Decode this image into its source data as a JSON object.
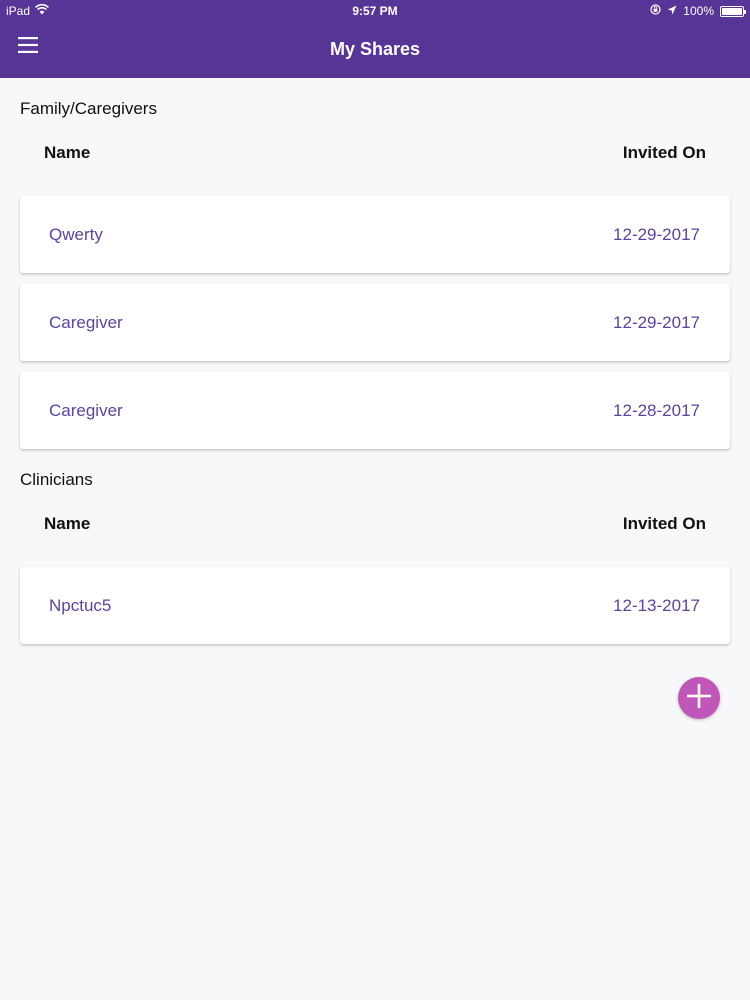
{
  "status_bar": {
    "device": "iPad",
    "time": "9:57 PM",
    "battery": "100%"
  },
  "header": {
    "title": "My Shares",
    "menu_icon": "hamburger-menu-icon"
  },
  "colors": {
    "header_bg": "#573596",
    "accent_text": "#5b44a0",
    "fab": "#c056b8"
  },
  "family_section": {
    "title": "Family/Caregivers",
    "col_name": "Name",
    "col_invited": "Invited On",
    "rows": [
      {
        "name": "Qwerty",
        "date": "12-29-2017"
      },
      {
        "name": "Caregiver",
        "date": "12-29-2017"
      },
      {
        "name": "Caregiver",
        "date": "12-28-2017"
      }
    ]
  },
  "clinicians_section": {
    "title": "Clinicians",
    "col_name": "Name",
    "col_invited": "Invited On",
    "rows": [
      {
        "name": "Npctuc5",
        "date": "12-13-2017"
      }
    ]
  },
  "fab": {
    "icon": "plus-icon"
  }
}
